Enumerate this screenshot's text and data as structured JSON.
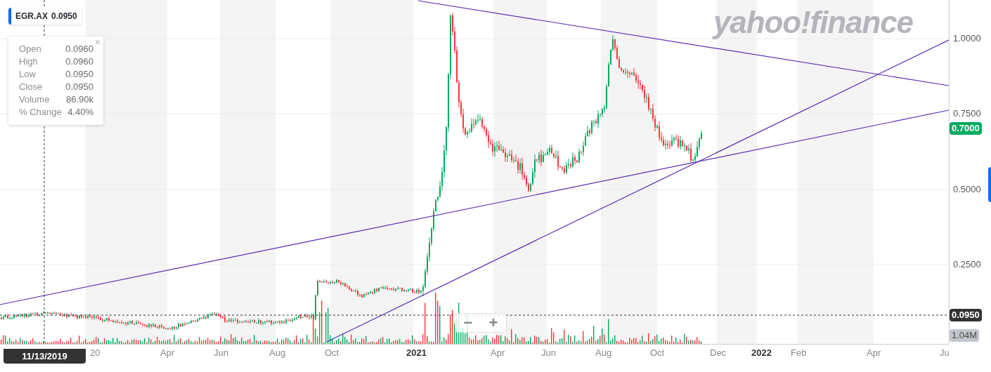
{
  "symbol_chip": {
    "symbol": "EGR.AX",
    "price": "0.0950"
  },
  "ohlc_tooltip": {
    "close_icon": "×",
    "rows": [
      {
        "label": "Open",
        "value": "0.0960"
      },
      {
        "label": "High",
        "value": "0.0960"
      },
      {
        "label": "Low",
        "value": "0.0950"
      },
      {
        "label": "Close",
        "value": "0.0950"
      },
      {
        "label": "Volume",
        "value": "86.90k"
      },
      {
        "label": "% Change",
        "value": "4.40%"
      }
    ]
  },
  "watermark_logo": "yahoo!finance",
  "y_axis": {
    "ticks": [
      "1.0000",
      "0.7500",
      "0.5000",
      "0.2500"
    ]
  },
  "price_badges": [
    {
      "kind": "current",
      "text": "0.7000"
    },
    {
      "kind": "crosshair",
      "text": "0.0950"
    },
    {
      "kind": "volume",
      "text": "1.04M"
    }
  ],
  "x_axis": {
    "labels": [
      {
        "text": "20",
        "kind": "month"
      },
      {
        "text": "Apr",
        "kind": "month"
      },
      {
        "text": "Jun",
        "kind": "month"
      },
      {
        "text": "Aug",
        "kind": "month"
      },
      {
        "text": "Oct",
        "kind": "month"
      },
      {
        "text": "2021",
        "kind": "year"
      },
      {
        "text": "Apr",
        "kind": "month"
      },
      {
        "text": "Jun",
        "kind": "month"
      },
      {
        "text": "Aug",
        "kind": "month"
      },
      {
        "text": "Oct",
        "kind": "month"
      },
      {
        "text": "Dec",
        "kind": "month"
      },
      {
        "text": "2022",
        "kind": "year"
      },
      {
        "text": "Feb",
        "kind": "month"
      },
      {
        "text": "Apr",
        "kind": "month"
      },
      {
        "text": "Ju",
        "kind": "month"
      }
    ]
  },
  "crosshair_date": "11/13/2019",
  "zoom_controls": [
    "−",
    "+"
  ]
}
